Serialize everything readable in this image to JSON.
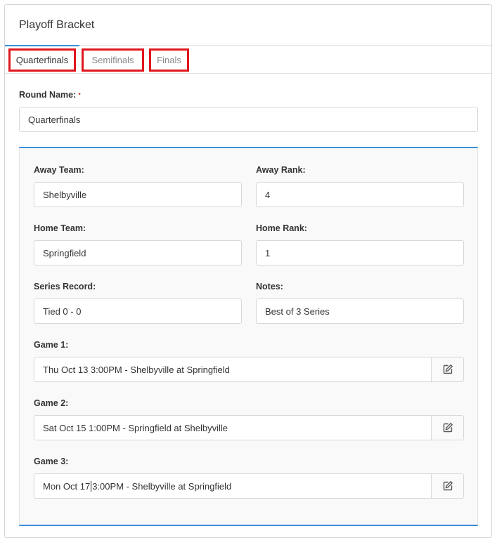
{
  "header": {
    "title": "Playoff Bracket"
  },
  "tabs": [
    {
      "label": "Quarterfinals"
    },
    {
      "label": "Semifinals"
    },
    {
      "label": "Finals"
    }
  ],
  "round": {
    "label": "Round Name:",
    "required_mark": "•",
    "value": "Quarterfinals"
  },
  "matchup": {
    "away_team": {
      "label": "Away Team:",
      "value": "Shelbyville"
    },
    "away_rank": {
      "label": "Away Rank:",
      "value": "4"
    },
    "home_team": {
      "label": "Home Team:",
      "value": "Springfield"
    },
    "home_rank": {
      "label": "Home Rank:",
      "value": "1"
    },
    "series_record": {
      "label": "Series Record:",
      "value": "Tied 0 - 0"
    },
    "notes": {
      "label": "Notes:",
      "value": "Best of 3 Series"
    },
    "games": [
      {
        "label": "Game 1:",
        "value": "Thu Oct 13 3:00PM - Shelbyville at Springfield"
      },
      {
        "label": "Game 2:",
        "value": "Sat Oct 15 1:00PM - Springfield at Shelbyville"
      },
      {
        "label": "Game 3:",
        "value_before_cursor": "Mon Oct 17",
        "value_after_cursor": "3:00PM - Shelbyville at Springfield"
      }
    ]
  },
  "icons": {
    "edit": "edit-icon"
  },
  "colors": {
    "accent": "#3a8fd8",
    "highlight_box": "#e0161d",
    "required": "#d9534f"
  }
}
